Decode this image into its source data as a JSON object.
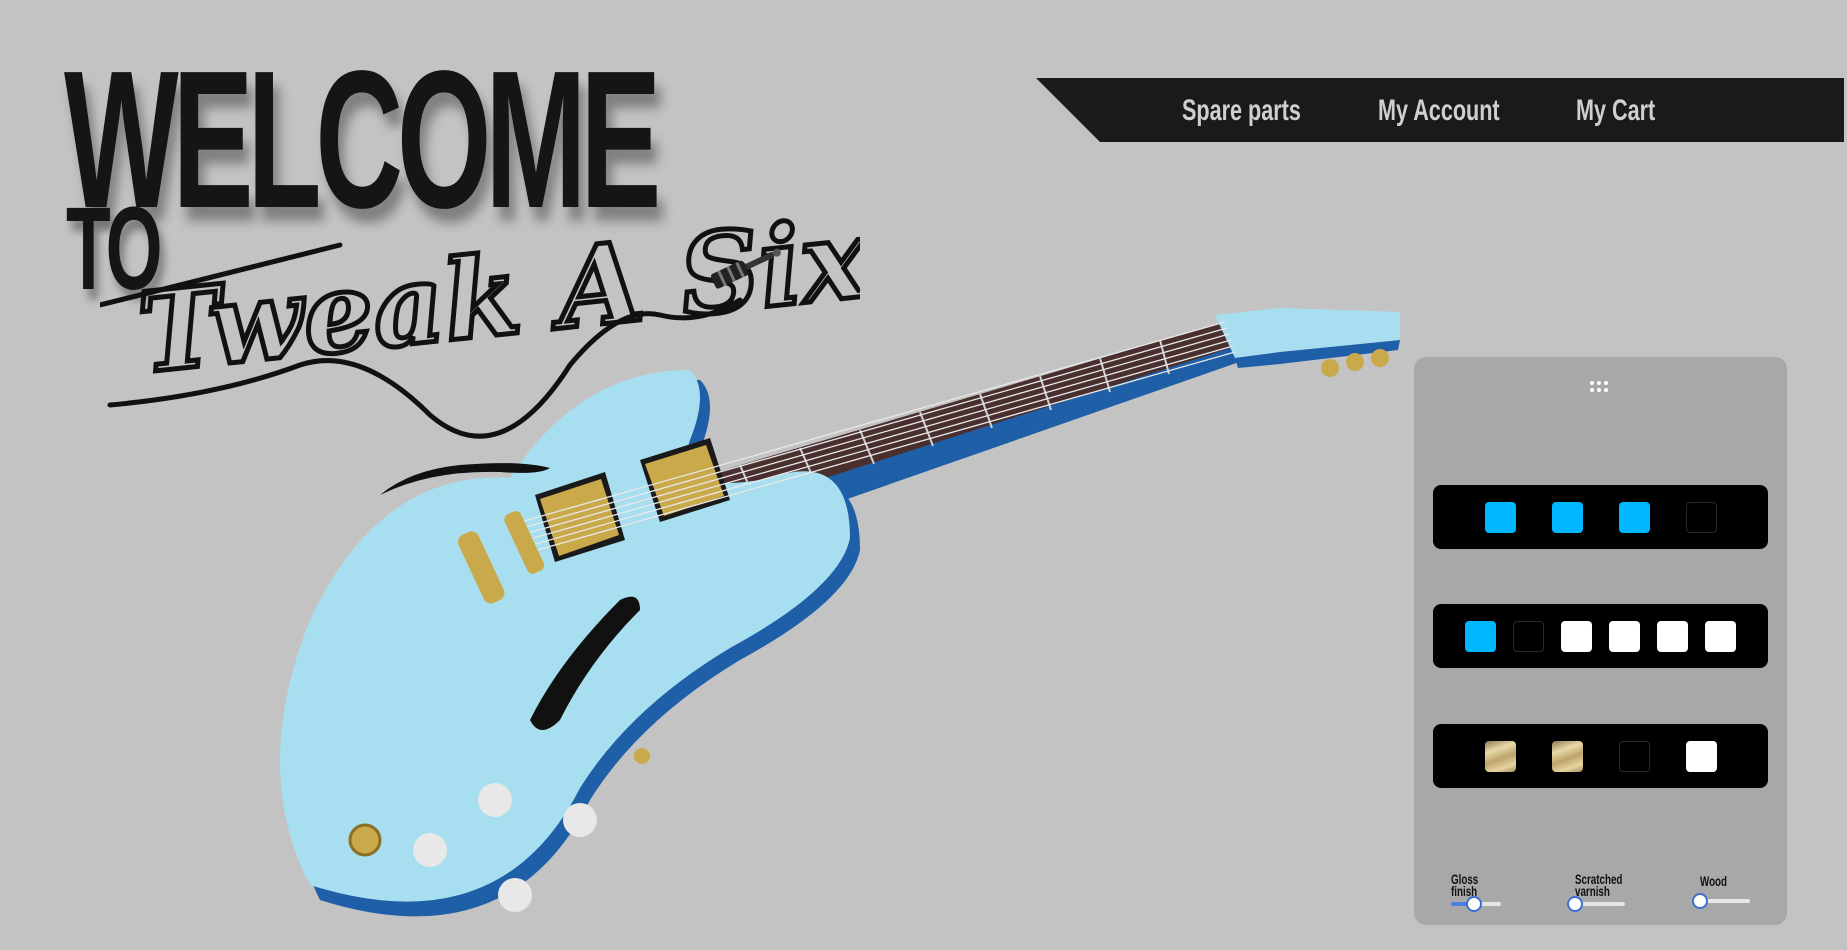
{
  "hero": {
    "welcome": "WELCOME",
    "to": "TO",
    "brand": "Tweak A Six"
  },
  "nav": {
    "items": [
      {
        "label": "Spare parts"
      },
      {
        "label": "My Account"
      },
      {
        "label": "My Cart"
      }
    ]
  },
  "customizer": {
    "drag_icon": "drag-handle-icon",
    "body_colors": [
      "#00b7ff",
      "#00b7ff",
      "#00b7ff",
      "#000000"
    ],
    "binding_colors": [
      "#00b7ff",
      "#000000",
      "#ffffff",
      "#ffffff",
      "#ffffff",
      "#ffffff"
    ],
    "hardware_finishes": [
      "gold",
      "gold",
      "black",
      "white"
    ],
    "sliders": [
      {
        "label": "Gloss\nfinish",
        "value": 0.45
      },
      {
        "label": "Scratched\nvarnish",
        "value": 0.0
      },
      {
        "label": "Wood",
        "value": 0.0
      }
    ]
  },
  "colors": {
    "background": "#c3c3c3",
    "nav_bg": "#1a1a1a",
    "accent_blue": "#00b7ff",
    "guitar_body": "#a8dff0",
    "guitar_side": "#1f5fa8"
  }
}
